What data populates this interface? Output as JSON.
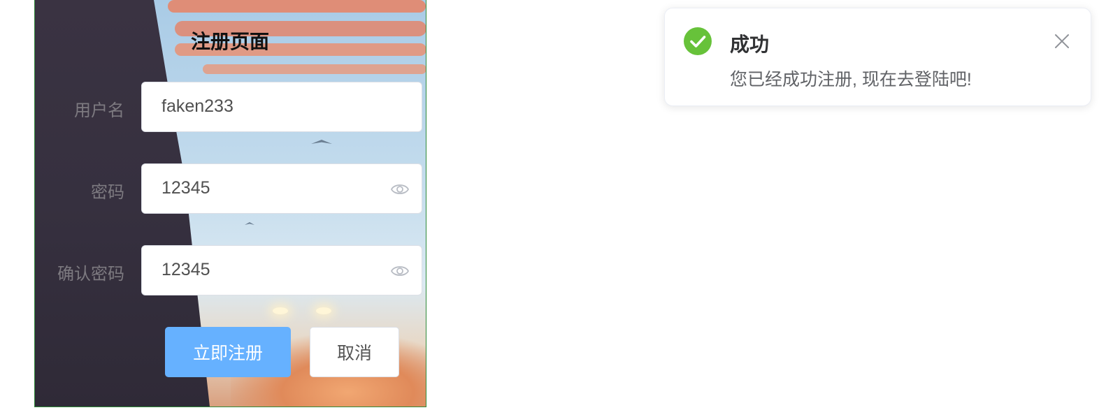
{
  "form": {
    "title": "注册页面",
    "username": {
      "label": "用户名",
      "value": "faken233"
    },
    "password": {
      "label": "密码",
      "value": "12345"
    },
    "confirm_password": {
      "label": "确认密码",
      "value": "12345"
    },
    "submit_label": "立即注册",
    "cancel_label": "取消"
  },
  "notification": {
    "type": "success",
    "icon": "check-circle-icon",
    "title": "成功",
    "message": "您已经成功注册, 现在去登陆吧!",
    "accent_color": "#67c23a"
  },
  "colors": {
    "primary_button": "#66b1ff",
    "panel_border": "#2f8a3a"
  }
}
